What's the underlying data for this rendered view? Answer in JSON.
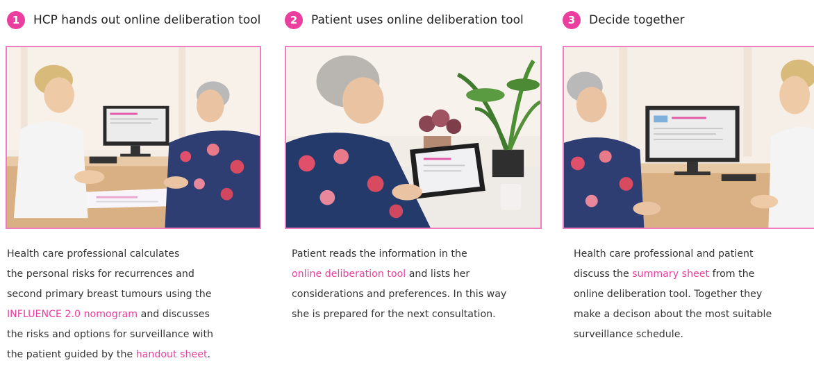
{
  "colors": {
    "accent": "#ea3f9e",
    "frame": "#ee7dc4"
  },
  "steps": [
    {
      "number": "1",
      "title": "HCP hands out online deliberation tool",
      "description_lines": [
        [
          {
            "text": "Health care professional calculates"
          }
        ],
        [
          {
            "text": "the personal risks for recurrences and"
          }
        ],
        [
          {
            "text": "second primary breast tumours using the"
          }
        ],
        [
          {
            "text": "INFLUENCE 2.0 nomogram",
            "highlight": true
          },
          {
            "text": " and discusses"
          }
        ],
        [
          {
            "text": "the risks and options for surveillance with"
          }
        ],
        [
          {
            "text": "the patient guided by the "
          },
          {
            "text": "handout sheet",
            "highlight": true
          },
          {
            "text": "."
          }
        ]
      ]
    },
    {
      "number": "2",
      "title": "Patient uses online deliberation tool",
      "description_lines": [
        [
          {
            "text": "Patient reads the information in the"
          }
        ],
        [
          {
            "text": "online deliberation tool",
            "highlight": true
          },
          {
            "text": " and lists her"
          }
        ],
        [
          {
            "text": "considerations and preferences. In this way"
          }
        ],
        [
          {
            "text": "she is prepared for the next consultation."
          }
        ]
      ]
    },
    {
      "number": "3",
      "title": "Decide together",
      "description_lines": [
        [
          {
            "text": "Health care professional and patient"
          }
        ],
        [
          {
            "text": "discuss the "
          },
          {
            "text": "summary sheet",
            "highlight": true
          },
          {
            "text": " from the"
          }
        ],
        [
          {
            "text": "online deliberation tool. Together they"
          }
        ],
        [
          {
            "text": "make a decison about the most suitable"
          }
        ],
        [
          {
            "text": "surveillance schedule."
          }
        ]
      ]
    }
  ]
}
